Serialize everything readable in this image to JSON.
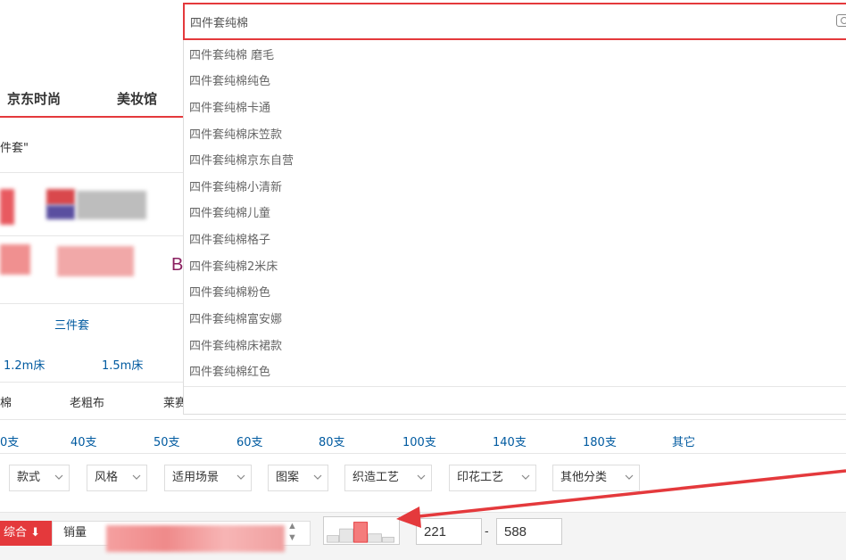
{
  "search": {
    "value": "四件套纯棉",
    "suggestions": [
      "四件套纯棉 磨毛",
      "四件套纯棉纯色",
      "四件套纯棉卡通",
      "四件套纯棉床笠款",
      "四件套纯棉京东自营",
      "四件套纯棉小清新",
      "四件套纯棉儿童",
      "四件套纯棉格子",
      "四件套纯棉2米床",
      "四件套纯棉粉色",
      "四件套纯棉富安娜",
      "四件套纯棉床裙款",
      "四件套纯棉红色"
    ]
  },
  "nav": {
    "items": [
      "京东时尚",
      "美妆馆"
    ]
  },
  "query_text": "件套\"",
  "brand_partial": "B",
  "set_option": "三件套",
  "bed_sizes": [
    "1.2m床",
    "1.5m床"
  ],
  "materials": [
    "棉",
    "老粗布",
    "莱赛"
  ],
  "thread_counts": [
    "0支",
    "40支",
    "50支",
    "60支",
    "80支",
    "100支",
    "140支",
    "180支",
    "其它"
  ],
  "filters": [
    "款式",
    "风格",
    "适用场景",
    "图案",
    "织造工艺",
    "印花工艺",
    "其他分类"
  ],
  "sort": {
    "default_label": "综合",
    "default_arrow": "⬇",
    "sales_label": "销量"
  },
  "price": {
    "min": "221",
    "max": "588",
    "separator": "-"
  },
  "colors": {
    "accent": "#e4393c",
    "link": "#005aa0"
  }
}
